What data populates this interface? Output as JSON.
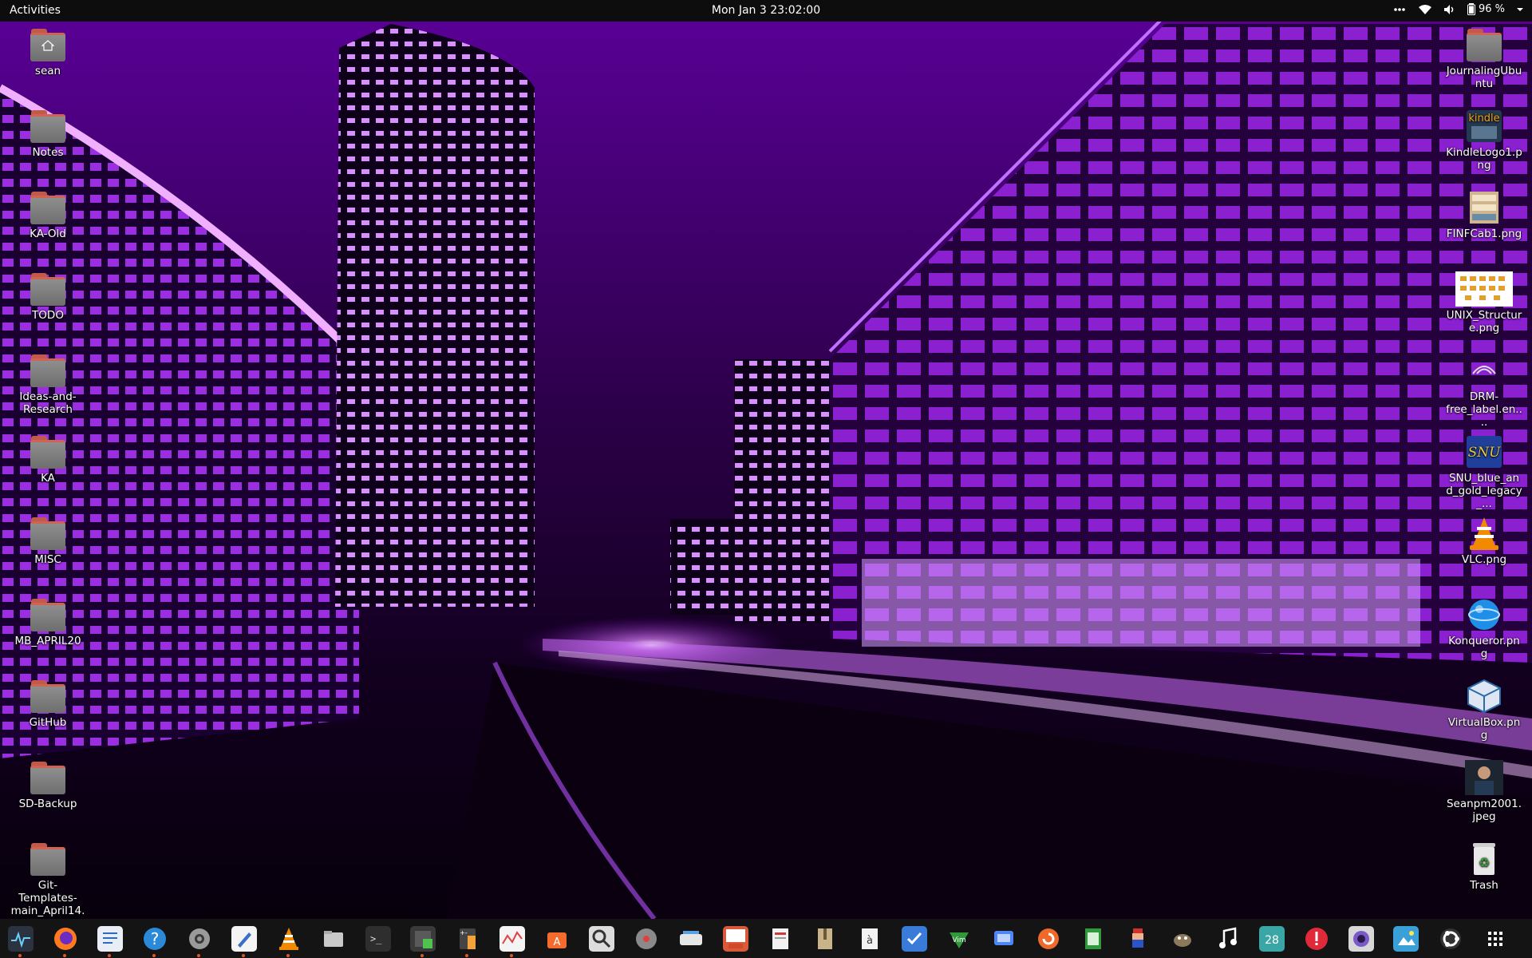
{
  "topbar": {
    "activities": "Activities",
    "clock": "Mon Jan 3  23:02:00",
    "overflow_icon": "more-horizontal-icon",
    "wifi_icon": "wifi-icon",
    "volume_icon": "volume-icon",
    "battery_icon": "battery-icon",
    "battery_percent": "96 %",
    "menu_arrow_icon": "chevron-down-icon"
  },
  "desktop": {
    "left_icons": [
      {
        "label": "sean",
        "icon": "home-folder-icon"
      },
      {
        "label": "Notes",
        "icon": "folder-icon"
      },
      {
        "label": "KA-Old",
        "icon": "folder-icon"
      },
      {
        "label": "TODO",
        "icon": "folder-icon"
      },
      {
        "label": "Ideas-and-Research",
        "icon": "folder-icon"
      },
      {
        "label": "KA",
        "icon": "folder-icon"
      },
      {
        "label": "MISC",
        "icon": "folder-icon"
      },
      {
        "label": "MB_APRIL20",
        "icon": "folder-icon"
      },
      {
        "label": "GitHub",
        "icon": "folder-icon"
      },
      {
        "label": "SD-Backup",
        "icon": "folder-icon"
      },
      {
        "label": "Git-Templates-main_April14...",
        "icon": "folder-icon"
      }
    ],
    "right_icons": [
      {
        "label": "JournalingUbuntu",
        "icon": "folder-icon"
      },
      {
        "label": "KindleLogo1.png",
        "icon": "kindle-logo-icon"
      },
      {
        "label": "FINFCab1.png",
        "icon": "filing-cabinet-icon"
      },
      {
        "label": "UNIX_Structure.png",
        "icon": "image-thumbnail-icon"
      },
      {
        "label": "DRM-free_label.en....",
        "icon": "drm-free-icon"
      },
      {
        "label": "SNU_blue_and_gold_legacy_...",
        "icon": "snu-logo-icon"
      },
      {
        "label": "VLC.png",
        "icon": "vlc-cone-icon"
      },
      {
        "label": "Konqueror.png",
        "icon": "konqueror-globe-icon"
      },
      {
        "label": "VirtualBox.png",
        "icon": "virtualbox-icon"
      },
      {
        "label": "Seanpm2001.jpeg",
        "icon": "photo-thumbnail-icon"
      },
      {
        "label": "Trash",
        "icon": "trash-icon"
      }
    ]
  },
  "dock": {
    "items": [
      {
        "name": "system-monitor-icon",
        "running": true
      },
      {
        "name": "firefox-icon",
        "running": true
      },
      {
        "name": "writer-document-icon",
        "running": true
      },
      {
        "name": "help-icon",
        "running": true
      },
      {
        "name": "settings-gear-icon",
        "running": true
      },
      {
        "name": "text-editor-icon",
        "running": true
      },
      {
        "name": "vlc-icon",
        "running": true
      },
      {
        "name": "files-icon",
        "running": false
      },
      {
        "name": "terminal-icon",
        "running": false
      },
      {
        "name": "extension-icon",
        "running": true
      },
      {
        "name": "calculator-icon",
        "running": true
      },
      {
        "name": "chart-app-icon",
        "running": true
      },
      {
        "name": "software-store-icon",
        "running": false
      },
      {
        "name": "search-magnifier-icon",
        "running": false
      },
      {
        "name": "disk-utility-icon",
        "running": false
      },
      {
        "name": "scanner-icon",
        "running": false
      },
      {
        "name": "presentation-icon",
        "running": false
      },
      {
        "name": "document-viewer-icon",
        "running": false
      },
      {
        "name": "archive-icon",
        "running": false
      },
      {
        "name": "character-map-icon",
        "running": false
      },
      {
        "name": "tasks-checklist-icon",
        "running": false
      },
      {
        "name": "vim-icon",
        "running": false
      },
      {
        "name": "screenshot-icon",
        "running": false
      },
      {
        "name": "update-icon",
        "running": false
      },
      {
        "name": "spreadsheet-icon",
        "running": false
      },
      {
        "name": "mario-game-icon",
        "running": false
      },
      {
        "name": "gimp-icon",
        "running": false
      },
      {
        "name": "music-note-icon",
        "running": false
      },
      {
        "name": "calendar-icon",
        "running": false
      },
      {
        "name": "alert-icon",
        "running": false
      },
      {
        "name": "webcam-icon",
        "running": false
      },
      {
        "name": "image-viewer-icon",
        "running": false
      },
      {
        "name": "ubuntu-logo-icon",
        "running": false
      },
      {
        "name": "show-apps-grid-icon",
        "running": false
      }
    ],
    "calendar_day": "28"
  },
  "colors": {
    "wallpaper": "#6a00b0",
    "topbar": "#0d0d0d",
    "dock": "#141414",
    "running_dot": "#e95420",
    "folder_tab": "#d06452",
    "folder_body": "#7f7f7f"
  }
}
